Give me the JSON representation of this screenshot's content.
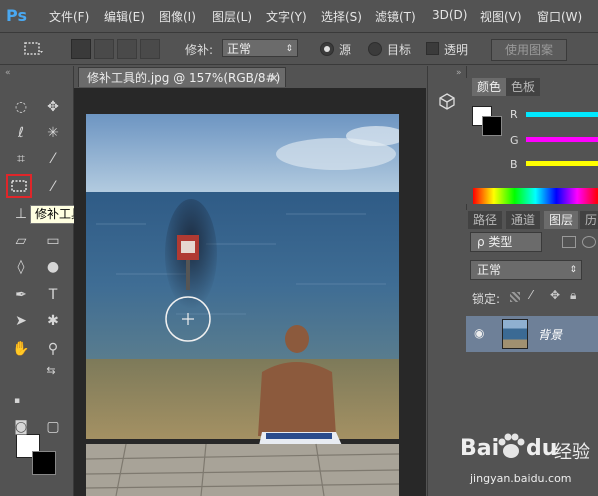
{
  "app": {
    "logo": "Ps"
  },
  "menu": [
    "文件(F)",
    "编辑(E)",
    "图像(I)",
    "图层(L)",
    "文字(Y)",
    "选择(S)",
    "滤镜(T)",
    "3D(D)",
    "视图(V)",
    "窗口(W)"
  ],
  "options": {
    "patch_label": "修补:",
    "patch_mode": "正常",
    "source_label": "源",
    "destination_label": "目标",
    "transparent_label": "透明",
    "use_pattern_label": "使用图案"
  },
  "toolbox": {
    "tooltip": "修补工具 (J)",
    "foreground_color": "#ffffff",
    "background_color": "#000000",
    "highlight_color": "#e0262a"
  },
  "document": {
    "tab_title": "修补工具的.jpg @ 157%(RGB/8#)",
    "close_glyph": "×"
  },
  "color_panel": {
    "tabs": [
      "颜色",
      "色板"
    ],
    "channels": [
      {
        "label": "R",
        "color": "#00e8ff"
      },
      {
        "label": "G",
        "color": "#ff00ff"
      },
      {
        "label": "B",
        "color": "#ffff00"
      }
    ]
  },
  "layers_panel": {
    "tabs": [
      "路径",
      "通道",
      "图层",
      "历"
    ],
    "filter_label": "ρ 类型",
    "blend_mode": "正常",
    "lock_label": "锁定:",
    "layers": [
      {
        "name": "背景",
        "visible": true
      }
    ]
  },
  "watermark": {
    "brand": "Bai",
    "brand2": "du",
    "suffix": "经验",
    "url": "jingyan.baidu.com"
  }
}
